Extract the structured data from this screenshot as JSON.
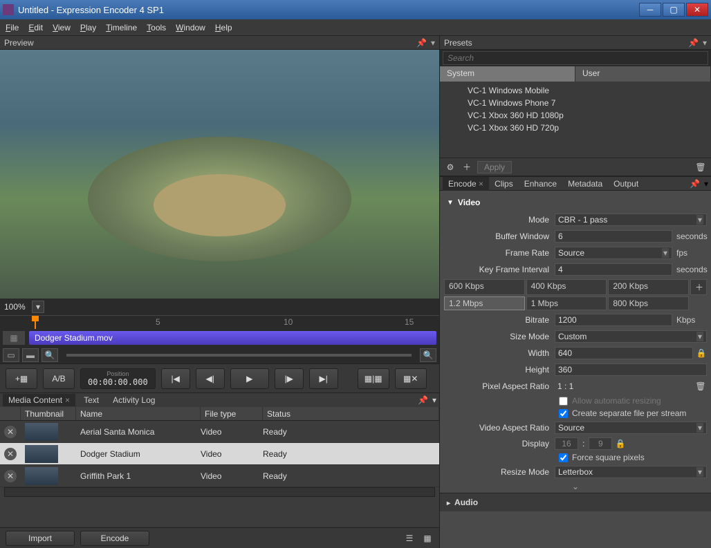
{
  "window": {
    "title": "Untitled - Expression Encoder 4 SP1"
  },
  "menu": [
    "File",
    "Edit",
    "View",
    "Play",
    "Timeline",
    "Tools",
    "Window",
    "Help"
  ],
  "panels": {
    "preview": "Preview",
    "presets": "Presets",
    "media_content": "Media Content",
    "text": "Text",
    "activity_log": "Activity Log"
  },
  "zoom": "100%",
  "timeline": {
    "clip_name": "Dodger Stadium.mov",
    "ticks": {
      "t5": "5",
      "t10": "10",
      "t15": "15"
    }
  },
  "transport": {
    "ab_label": "A/B",
    "position_label": "Position",
    "position": "00:00:00.000"
  },
  "media": {
    "cols": {
      "thumb": "Thumbnail",
      "name": "Name",
      "type": "File type",
      "status": "Status"
    },
    "rows": [
      {
        "name": "Aerial Santa Monica",
        "type": "Video",
        "status": "Ready"
      },
      {
        "name": "Dodger Stadium",
        "type": "Video",
        "status": "Ready"
      },
      {
        "name": "Griffith Park 1",
        "type": "Video",
        "status": "Ready"
      }
    ]
  },
  "footer": {
    "import": "Import",
    "encode": "Encode"
  },
  "presets": {
    "search_placeholder": "Search",
    "tabs": {
      "system": "System",
      "user": "User"
    },
    "items": [
      "VC-1 Windows Mobile",
      "VC-1 Windows Phone 7",
      "VC-1 Xbox 360 HD 1080p",
      "VC-1 Xbox 360 HD 720p"
    ],
    "apply": "Apply"
  },
  "encode_tabs": {
    "encode": "Encode",
    "clips": "Clips",
    "enhance": "Enhance",
    "metadata": "Metadata",
    "output": "Output"
  },
  "video": {
    "section": "Video",
    "mode_label": "Mode",
    "mode": "CBR - 1 pass",
    "buffer_label": "Buffer Window",
    "buffer": "6",
    "seconds": "seconds",
    "framerate_label": "Frame Rate",
    "framerate": "Source",
    "fps": "fps",
    "keyframe_label": "Key Frame Interval",
    "keyframe": "4",
    "bitrate_presets": [
      "600 Kbps",
      "400 Kbps",
      "200 Kbps",
      "1.2 Mbps",
      "1 Mbps",
      "800 Kbps"
    ],
    "bitrate_label": "Bitrate",
    "bitrate": "1200",
    "kbps": "Kbps",
    "sizemode_label": "Size Mode",
    "sizemode": "Custom",
    "width_label": "Width",
    "width": "640",
    "height_label": "Height",
    "height": "360",
    "par_label": "Pixel Aspect Ratio",
    "par": "1 : 1",
    "allow_resize": "Allow automatic resizing",
    "separate_file": "Create separate file per stream",
    "var_label": "Video Aspect Ratio",
    "var": "Source",
    "display_label": "Display",
    "display_w": "16",
    "display_h": "9",
    "force_square": "Force square pixels",
    "resize_label": "Resize Mode",
    "resize": "Letterbox"
  },
  "audio": {
    "section": "Audio"
  }
}
